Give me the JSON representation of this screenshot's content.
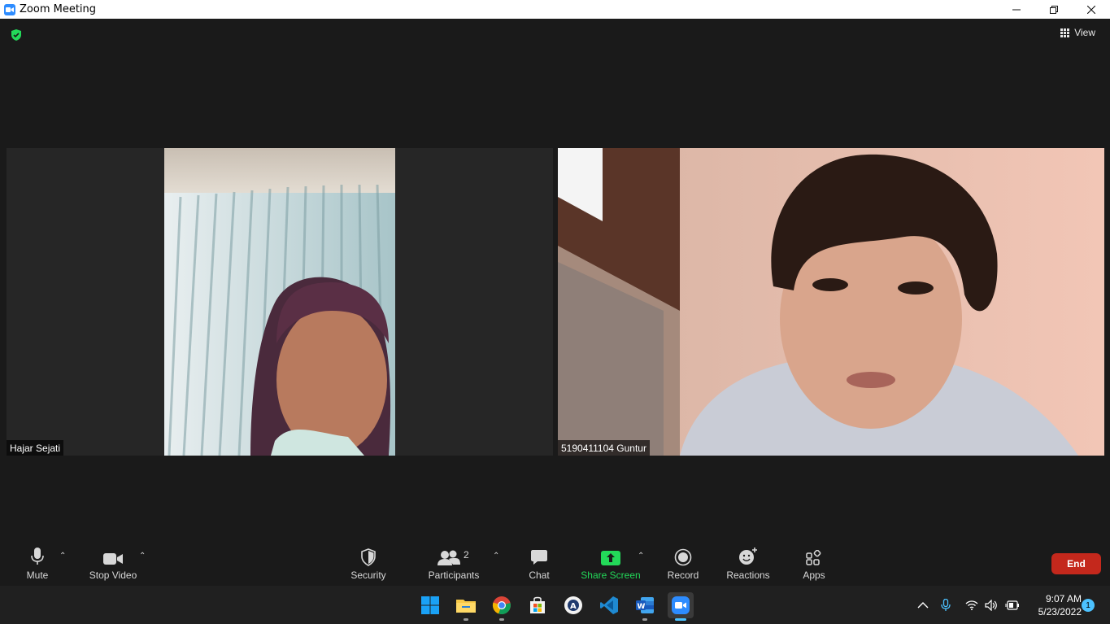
{
  "window": {
    "title": "Zoom Meeting"
  },
  "meeting": {
    "view_label": "View",
    "participants_tiles": [
      {
        "name": "Hajar Sejati"
      },
      {
        "name": "5190411104 Guntur"
      }
    ]
  },
  "toolbar": {
    "mute_label": "Mute",
    "stop_video_label": "Stop Video",
    "security_label": "Security",
    "participants_label": "Participants",
    "participants_count": "2",
    "chat_label": "Chat",
    "share_screen_label": "Share Screen",
    "record_label": "Record",
    "reactions_label": "Reactions",
    "apps_label": "Apps",
    "end_label": "End"
  },
  "taskbar": {
    "time": "9:07 AM",
    "date": "5/23/2022",
    "notification_count": "1",
    "apps": [
      "windows-start-icon",
      "file-explorer-icon",
      "chrome-icon",
      "microsoft-store-icon",
      "app-icon",
      "vscode-icon",
      "word-icon",
      "zoom-icon"
    ]
  },
  "colors": {
    "end_button": "#c4281c",
    "share_screen_green": "#23d959",
    "accent_blue": "#2d8cff",
    "security_shield": "#23d959"
  }
}
